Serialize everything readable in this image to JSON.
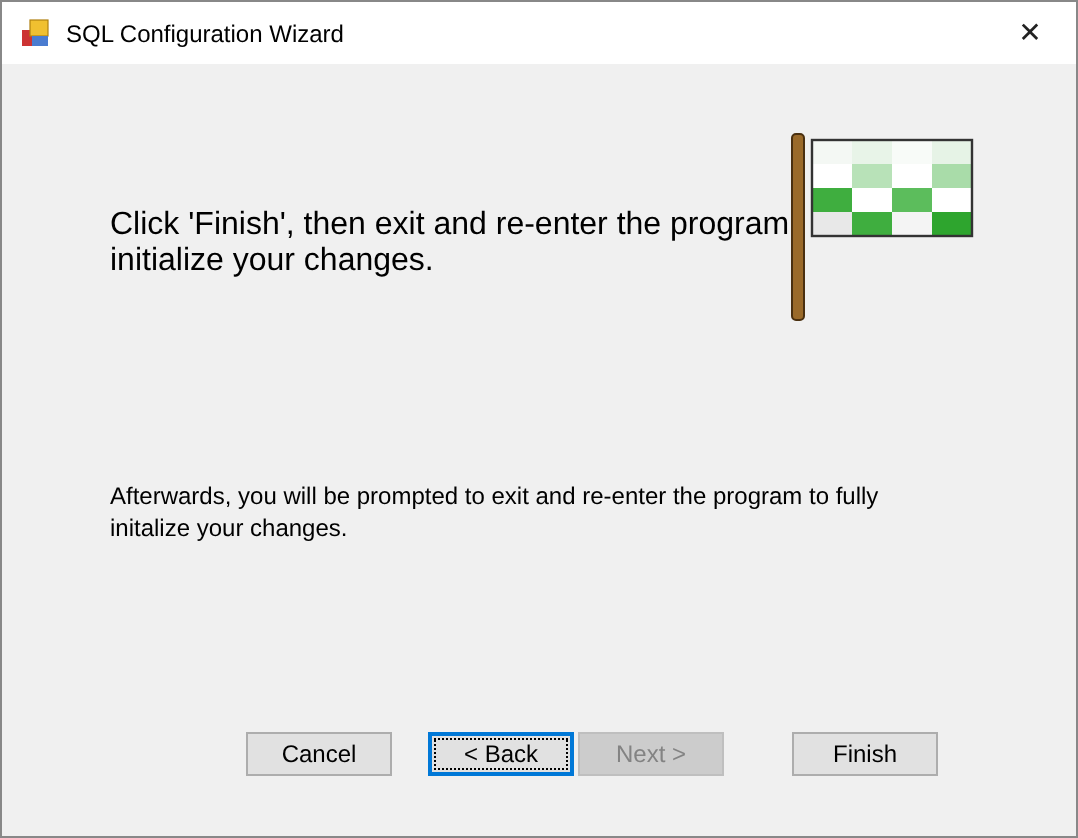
{
  "window": {
    "title": "SQL Configuration Wizard",
    "close": "✕"
  },
  "heading": "Click 'Finish', then exit and re-enter the program initialize your changes.",
  "note": "Afterwards, you will be prompted to exit and re-enter the program to fully initalize your changes.",
  "buttons": [
    {
      "label": "Cancel",
      "disabled": false,
      "focused": false
    },
    {
      "label": "< Back",
      "disabled": false,
      "focused": true
    },
    {
      "label": "Next >",
      "disabled": true,
      "focused": false
    },
    {
      "label": "Finish",
      "disabled": false,
      "focused": false
    }
  ]
}
